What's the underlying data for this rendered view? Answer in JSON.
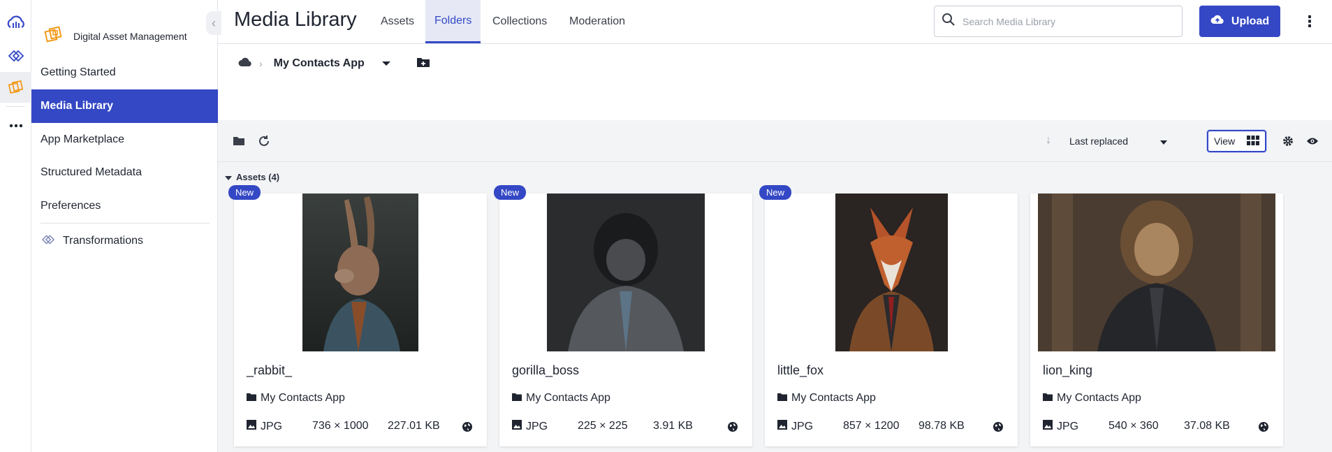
{
  "rail": {
    "items": [
      {
        "icon": "cloud-logo-icon"
      },
      {
        "icon": "transformations-icon"
      },
      {
        "icon": "digital-asset-management-icon"
      },
      {
        "icon": "more-apps-icon"
      }
    ]
  },
  "sidebar": {
    "product": "Digital Asset Management",
    "items": [
      {
        "label": "Getting Started"
      },
      {
        "label": "Media Library"
      },
      {
        "label": "App Marketplace"
      },
      {
        "label": "Structured Metadata"
      },
      {
        "label": "Preferences"
      }
    ],
    "transformations_label": "Transformations"
  },
  "header": {
    "title": "Media Library",
    "tabs": [
      {
        "label": "Assets"
      },
      {
        "label": "Folders"
      },
      {
        "label": "Collections"
      },
      {
        "label": "Moderation"
      }
    ],
    "search_placeholder": "Search Media Library",
    "upload_label": "Upload"
  },
  "breadcrumb": {
    "current": "My Contacts App"
  },
  "toolbar": {
    "sort_label": "Last replaced",
    "view_label": "View"
  },
  "assets": {
    "header": "Assets (4)",
    "items": [
      {
        "name": "_rabbit_",
        "folder": "My Contacts App",
        "format": "JPG",
        "dimensions": "736 × 1000",
        "size": "227.01 KB",
        "badge": "New"
      },
      {
        "name": "gorilla_boss",
        "folder": "My Contacts App",
        "format": "JPG",
        "dimensions": "225 × 225",
        "size": "3.91 KB",
        "badge": "New"
      },
      {
        "name": "little_fox",
        "folder": "My Contacts App",
        "format": "JPG",
        "dimensions": "857 × 1200",
        "size": "98.78 KB",
        "badge": "New"
      },
      {
        "name": "lion_king",
        "folder": "My Contacts App",
        "format": "JPG",
        "dimensions": "540 × 360",
        "size": "37.08 KB",
        "badge": ""
      }
    ]
  },
  "colors": {
    "accent": "#3448c5",
    "brand_orange": "#f29a1a",
    "background_gray": "#f3f4f6"
  }
}
